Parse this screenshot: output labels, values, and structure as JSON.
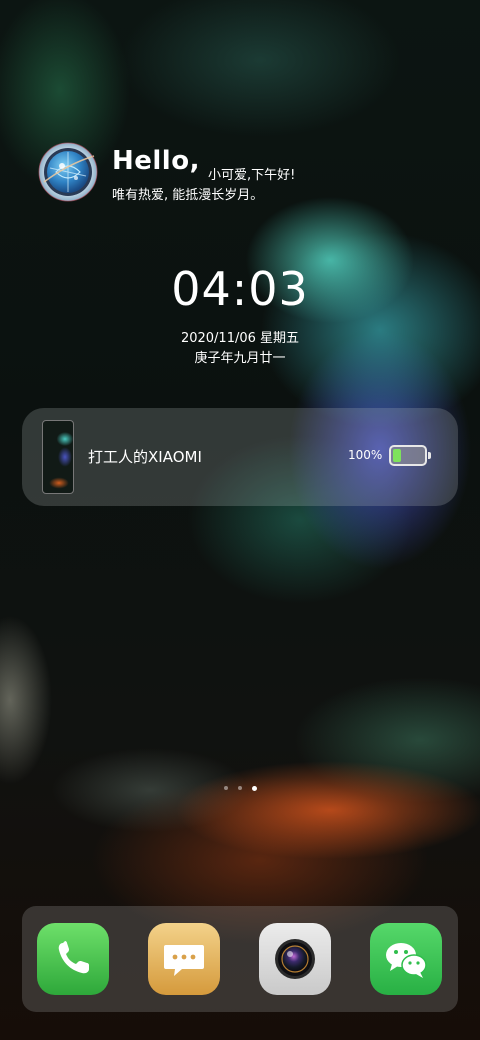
{
  "greeting": {
    "hello": "Hello,",
    "subtitle": "小可爱,下午好!",
    "motto": "唯有热爱, 能抵漫长岁月。"
  },
  "clock": {
    "time": "04:03",
    "date": "2020/11/06 星期五",
    "lunar_date": "庚子年九月廿一"
  },
  "device_card": {
    "name": "打工人的XIAOMI",
    "battery_percent_label": "100%",
    "battery_fill_fraction": 0.25
  },
  "pager": {
    "count": 3,
    "active_index": 2
  },
  "dock": {
    "apps": [
      {
        "icon": "phone-icon",
        "color": "#3fbf45"
      },
      {
        "icon": "message-icon",
        "color": "#e0ab52"
      },
      {
        "icon": "camera-icon",
        "color": "#dadada"
      },
      {
        "icon": "wechat-icon",
        "color": "#2fbe4c"
      }
    ]
  },
  "colors": {
    "battery_fill": "#7ee25c",
    "card_background": "rgba(190,200,200,0.22)"
  }
}
